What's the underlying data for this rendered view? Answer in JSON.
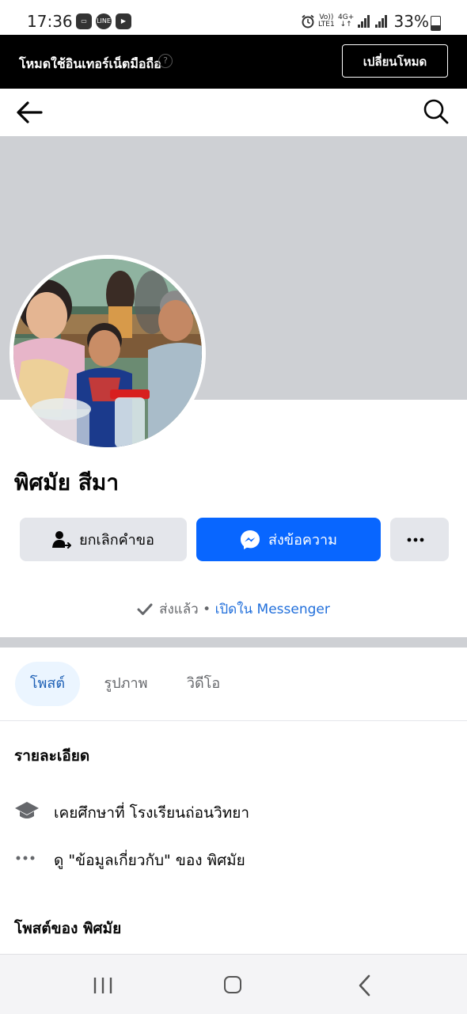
{
  "status_bar": {
    "time": "17:36",
    "notif_icons": [
      "voicemail-icon",
      "line-app-icon",
      "play-app-icon"
    ],
    "battery": "33%",
    "network_top": "Vo))",
    "network_bottom": "LTE1",
    "data_top": "4G+",
    "data_bottom": "↓↑"
  },
  "mode_banner": {
    "text": "โหมดใช้อินเทอร์เน็ตมือถือ",
    "button_label": "เปลี่ยนโหมด"
  },
  "profile": {
    "name": "พิศมัย สีมา"
  },
  "actions": {
    "cancel_request_label": "ยกเลิกคำขอ",
    "message_label": "ส่งข้อความ",
    "more_label": "···"
  },
  "sent_status": {
    "sent_text": "ส่งแล้ว",
    "separator": " • ",
    "open_link": "เปิดใน Messenger"
  },
  "tabs": [
    {
      "label": "โพสต์",
      "active": true
    },
    {
      "label": "รูปภาพ",
      "active": false
    },
    {
      "label": "วิดีโอ",
      "active": false
    }
  ],
  "details": {
    "title": "รายละเอียด",
    "items": [
      {
        "icon": "graduation-cap-icon",
        "text": "เคยศึกษาที่ โรงเรียนถ่อนวิทยา"
      },
      {
        "icon": "more-dots-icon",
        "text": "ดู \"ข้อมูลเกี่ยวกับ\" ของ พิศมัย"
      }
    ]
  },
  "posts_section": {
    "title": "โพสต์ของ พิศมัย"
  },
  "colors": {
    "primary_blue": "#0866ff",
    "cover_gray": "#ced0d4",
    "button_gray": "#e4e6eb",
    "link_blue": "#216fdb"
  }
}
